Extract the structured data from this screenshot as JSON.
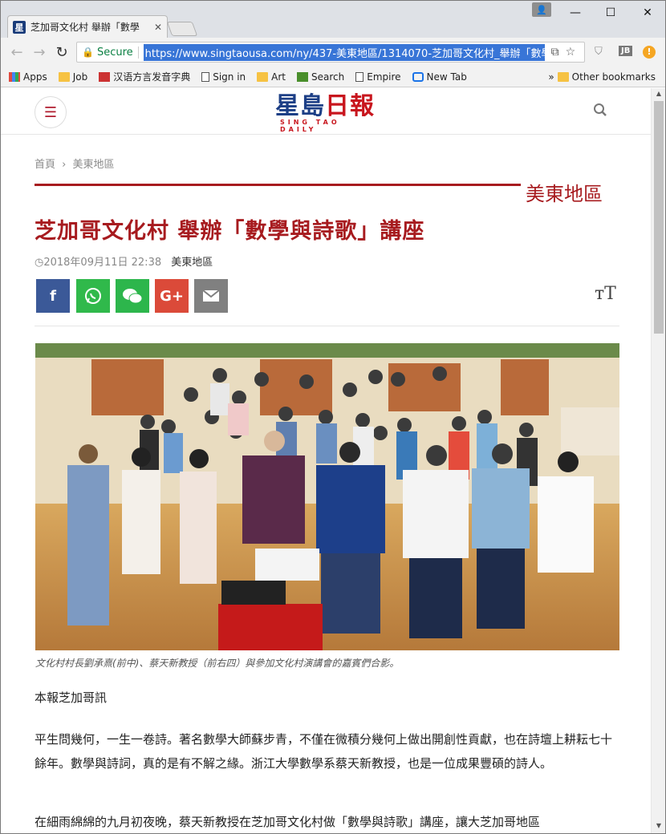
{
  "browser": {
    "tab_title": "芝加哥文化村 舉辦「數學",
    "url": "https://www.singtaousa.com/ny/437-美東地區/1314070-芝加哥文化村_舉辦「數學",
    "secure_label": "Secure",
    "bookmarks": [
      "Apps",
      "Job",
      "汉语方言发音字典",
      "Sign in",
      "Art",
      "Search",
      "Empire",
      "New Tab"
    ],
    "other_bookmarks": "Other bookmarks"
  },
  "site": {
    "logo_text_blue": "星島",
    "logo_text_red": "日報",
    "logo_sub": "SING TAO DAILY"
  },
  "article": {
    "breadcrumb_home": "首頁",
    "breadcrumb_sep": "›",
    "breadcrumb_section": "美東地區",
    "section_label": "美東地區",
    "headline": "芝加哥文化村  舉辦「數學與詩歌」講座",
    "timestamp": "2018年09月11日 22:38",
    "category": "美東地區",
    "caption": "文化村村長劉承熹(前中)、蔡天新教授（前右四）與參加文化村演講會的嘉賓們合影。",
    "paragraphs": [
      "本報芝加哥訊",
      "平生問幾何，一生一卷詩。著名數學大師蘇步青，不僅在微積分幾何上做出開創性貢獻，也在詩壇上耕耘七十餘年。數學與詩詞，真的是有不解之緣。浙江大學數學系蔡天新教授，也是一位成果豐碩的詩人。",
      "在細雨綿綿的九月初夜晚，蔡天新教授在芝加哥文化村做「數學與詩歌」講座，讓大芝加哥地區"
    ]
  },
  "colors": {
    "brand_red": "#a71b1f",
    "brand_blue": "#1d3f86",
    "facebook": "#3b5998",
    "whatsapp": "#30b94b",
    "wechat": "#2db64c",
    "googleplus": "#db4a39",
    "email": "#808080"
  }
}
